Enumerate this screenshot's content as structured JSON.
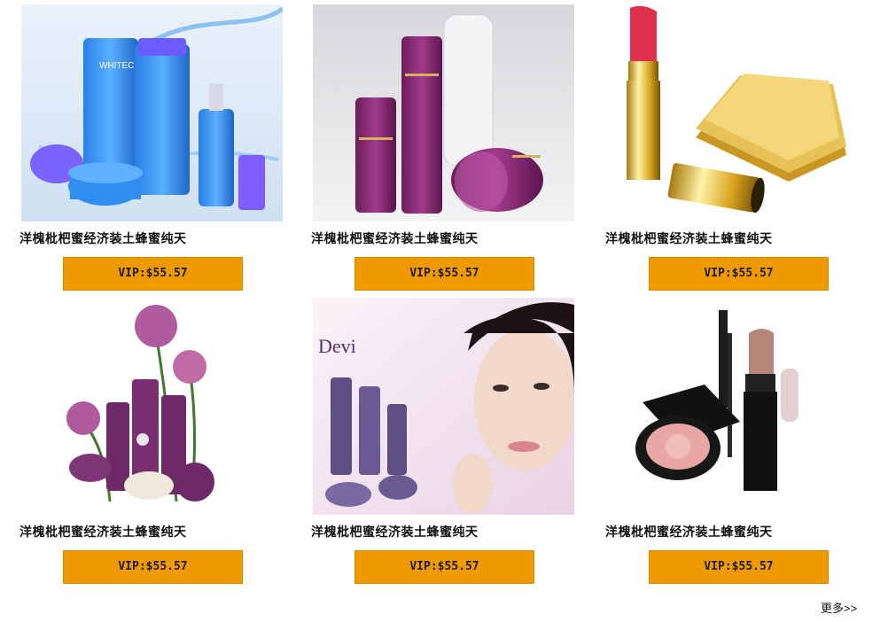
{
  "products": [
    {
      "name": "洋槐枇杷蜜经济装土蜂蜜纯天",
      "price": "VIP:$55.57",
      "image": "whitech-blue-skincare"
    },
    {
      "name": "洋槐枇杷蜜经济装土蜂蜜纯天",
      "price": "VIP:$55.57",
      "image": "purple-skincare-set"
    },
    {
      "name": "洋槐枇杷蜜经济装土蜂蜜纯天",
      "price": "VIP:$55.57",
      "image": "lipstick-and-compact"
    },
    {
      "name": "洋槐枇杷蜜经济装土蜂蜜纯天",
      "price": "VIP:$55.57",
      "image": "purple-bottles-allium-flowers"
    },
    {
      "name": "洋槐枇杷蜜经济装土蜂蜜纯天",
      "price": "VIP:$55.57",
      "image": "devi-model-advert"
    },
    {
      "name": "洋槐枇杷蜜经济装土蜂蜜纯天",
      "price": "VIP:$55.57",
      "image": "blush-mascara-lipstick"
    }
  ],
  "image_text": {
    "whitech_brand": "WHITECH",
    "devi_brand": "Devi"
  },
  "more_link": "更多>>",
  "colors": {
    "vip_button": "#ee9a00"
  }
}
